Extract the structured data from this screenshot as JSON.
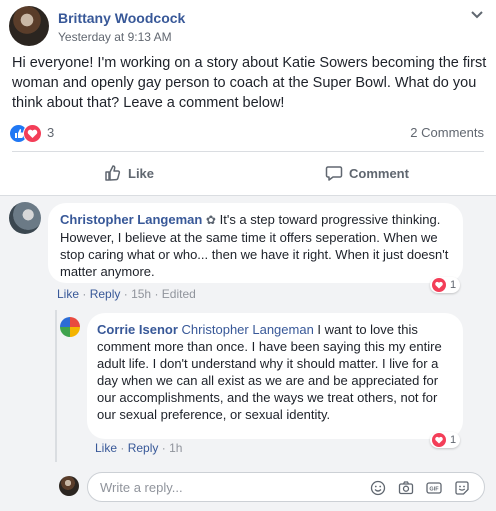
{
  "post": {
    "author": "Brittany Woodcock",
    "timestamp": "Yesterday at 9:13 AM",
    "text": "Hi everyone! I'm working on a story about Katie Sowers becoming the first woman and openly gay person to coach at the Super Bowl. What do you think about that? Leave a comment below!",
    "reaction_count": "3",
    "comments_count": "2 Comments",
    "like_label": "Like",
    "comment_label": "Comment"
  },
  "comments": [
    {
      "name": "Christopher Langeman",
      "text": "It's a step toward progressive thinking. However, I believe at the same time it offers seperation. When we stop caring what or who... then we have it right. When it just doesn't matter anymore.",
      "like": "Like",
      "reply": "Reply",
      "time": "15h",
      "edited": "Edited",
      "reactions": "1"
    },
    {
      "name": "Corrie Isenor",
      "mention": "Christopher Langeman",
      "text": "I want to love this comment more than once. I have been saying this my entire adult life. I don't understand why it should matter. I live for a day when we can all exist as we are and be appreciated for our accomplishments, and the ways we treat others, not for our sexual preference, or sexual identity.",
      "like": "Like",
      "reply": "Reply",
      "time": "1h",
      "reactions": "1"
    }
  ],
  "reply_box": {
    "placeholder": "Write a reply...",
    "icons": [
      "emoji-icon",
      "camera-icon",
      "gif-icon",
      "sticker-icon"
    ]
  },
  "colors": {
    "link": "#385898",
    "like_blue": "#2078f4",
    "love_red": "#f33e58",
    "comment_bg": "#f2f3f5"
  }
}
